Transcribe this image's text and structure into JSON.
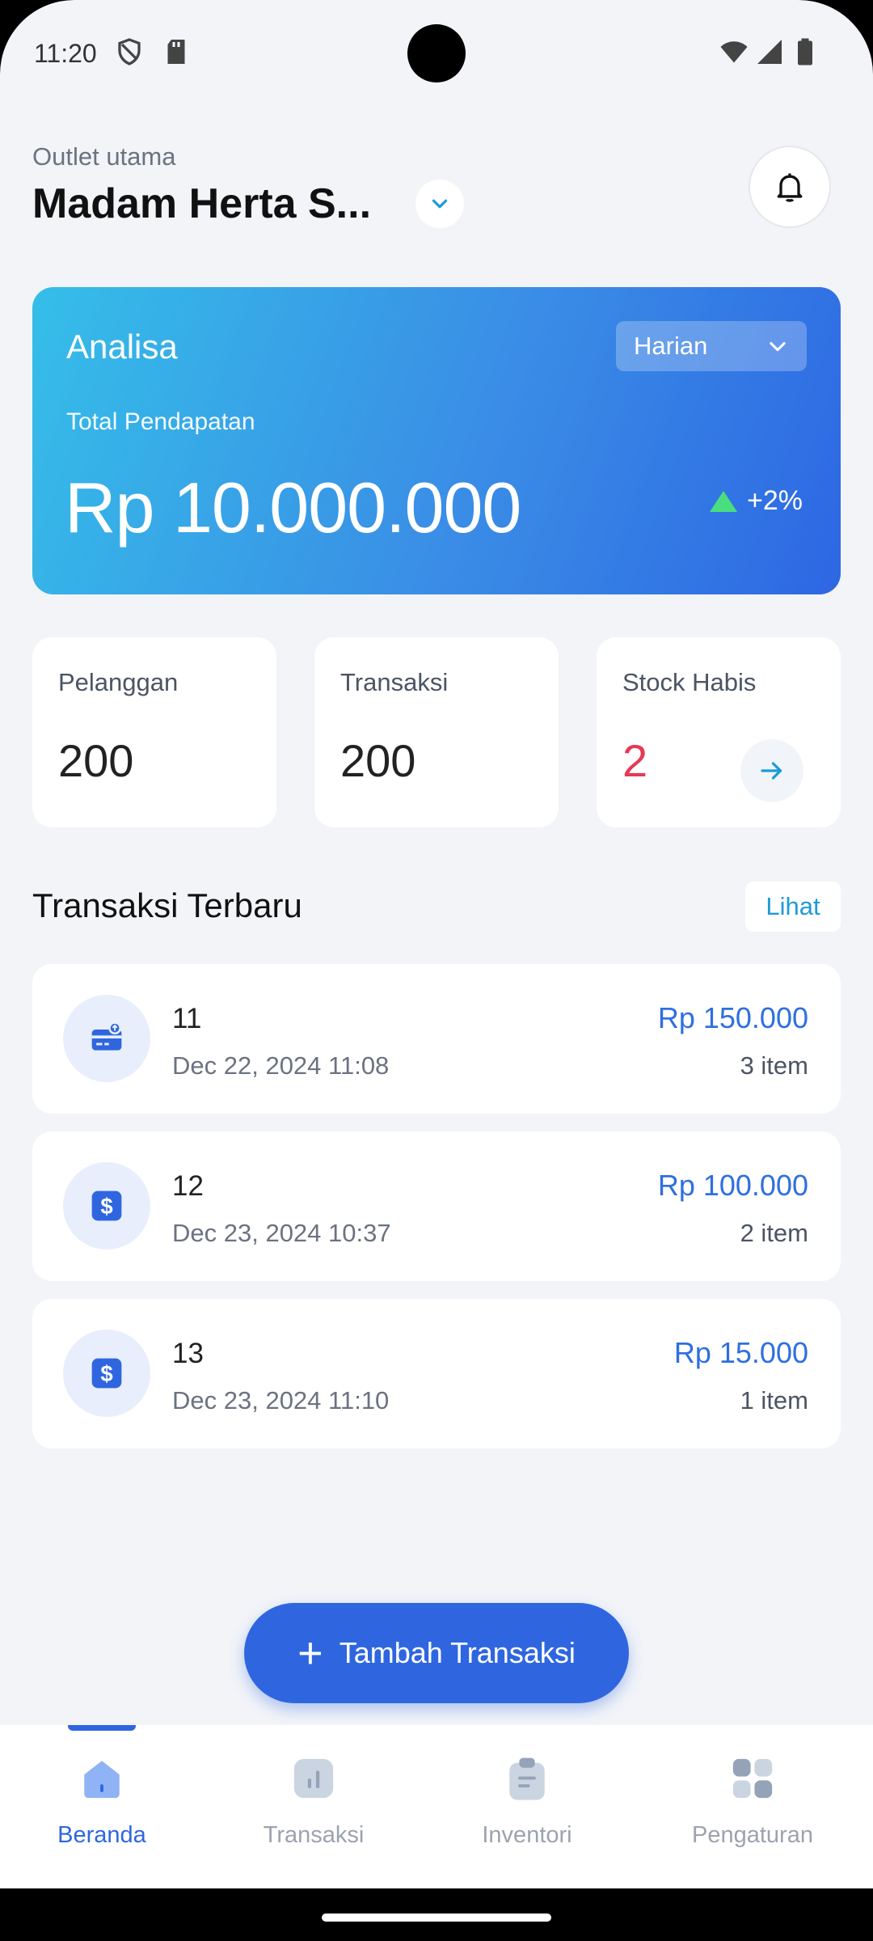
{
  "status_bar": {
    "time": "11:20",
    "icons": [
      "shield-icon",
      "sd-card-icon",
      "wifi-icon",
      "signal-icon",
      "battery-icon"
    ]
  },
  "header": {
    "outlet_label": "Outlet utama",
    "outlet_name": "Madam Herta S...",
    "toggle_icon": "chevron-down-icon",
    "notification_icon": "bell-icon"
  },
  "analysis": {
    "title": "Analisa",
    "period": "Harian",
    "total_label": "Total Pendapatan",
    "total_value": "Rp 10.000.000",
    "growth": "+2%",
    "colors": {
      "gradient_start": "#35BEE8",
      "gradient_end": "#2D67E3",
      "growth": "#4ADE80"
    }
  },
  "stats": [
    {
      "label": "Pelanggan",
      "value": "200"
    },
    {
      "label": "Transaksi",
      "value": "200"
    },
    {
      "label": "Stock Habis",
      "value": "2",
      "action_icon": "arrow-right-icon"
    }
  ],
  "recent": {
    "title": "Transaksi Terbaru",
    "see_all": "Lihat",
    "items": [
      {
        "id": "11",
        "date": "Dec 22, 2024 11:08",
        "amount": "Rp 150.000",
        "items": "3 item",
        "icon": "card-icon"
      },
      {
        "id": "12",
        "date": "Dec 23, 2024 10:37",
        "amount": "Rp 100.000",
        "items": "2 item",
        "icon": "dollar-icon"
      },
      {
        "id": "13",
        "date": "Dec 23, 2024 11:10",
        "amount": "Rp 15.000",
        "items": "1 item",
        "icon": "dollar-icon"
      }
    ]
  },
  "fab": {
    "label": "Tambah Transaksi",
    "icon": "plus-icon"
  },
  "nav": [
    {
      "label": "Beranda",
      "icon": "home-icon",
      "active": true
    },
    {
      "label": "Transaksi",
      "icon": "chart-icon",
      "active": false
    },
    {
      "label": "Inventori",
      "icon": "clipboard-icon",
      "active": false
    },
    {
      "label": "Pengaturan",
      "icon": "grid-icon",
      "active": false
    }
  ],
  "colors": {
    "primary": "#2F66E0",
    "danger": "#E53956",
    "link": "#1E9BD7",
    "background": "#F2F4F8"
  }
}
